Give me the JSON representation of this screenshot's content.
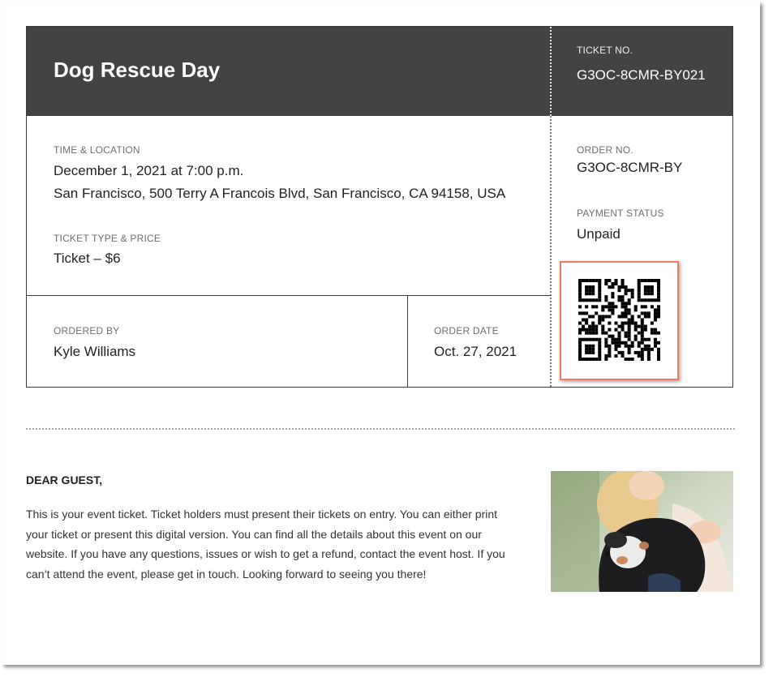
{
  "ticket": {
    "title": "Dog Rescue Day",
    "ticket_no_label": "TICKET NO.",
    "ticket_no": "G3OC-8CMR-BY021",
    "time_location_label": "TIME & LOCATION",
    "datetime": "December 1, 2021 at 7:00 p.m.",
    "location": "San Francisco, 500 Terry A Francois Blvd, San Francisco, CA 94158, USA",
    "type_price_label": "TICKET TYPE & PRICE",
    "type_price": "Ticket – $6",
    "ordered_by_label": "ORDERED BY",
    "ordered_by": "Kyle Williams",
    "order_date_label": "ORDER DATE",
    "order_date": "Oct. 27, 2021",
    "order_no_label": "ORDER NO.",
    "order_no": "G3OC-8CMR-BY",
    "payment_status_label": "PAYMENT STATUS",
    "payment_status": "Unpaid"
  },
  "message": {
    "greeting": "DEAR GUEST,",
    "body": "This is your event ticket. Ticket holders must present their tickets on entry. You can either print your ticket or present this digital version. You can find all the details about this event on our website. If you have any questions, issues or wish to get a refund, contact the event host. If you can’t attend the event, please get in touch. Looking forward to seeing you there!"
  },
  "colors": {
    "header_bg": "#434345",
    "highlight": "#ef7a62"
  }
}
